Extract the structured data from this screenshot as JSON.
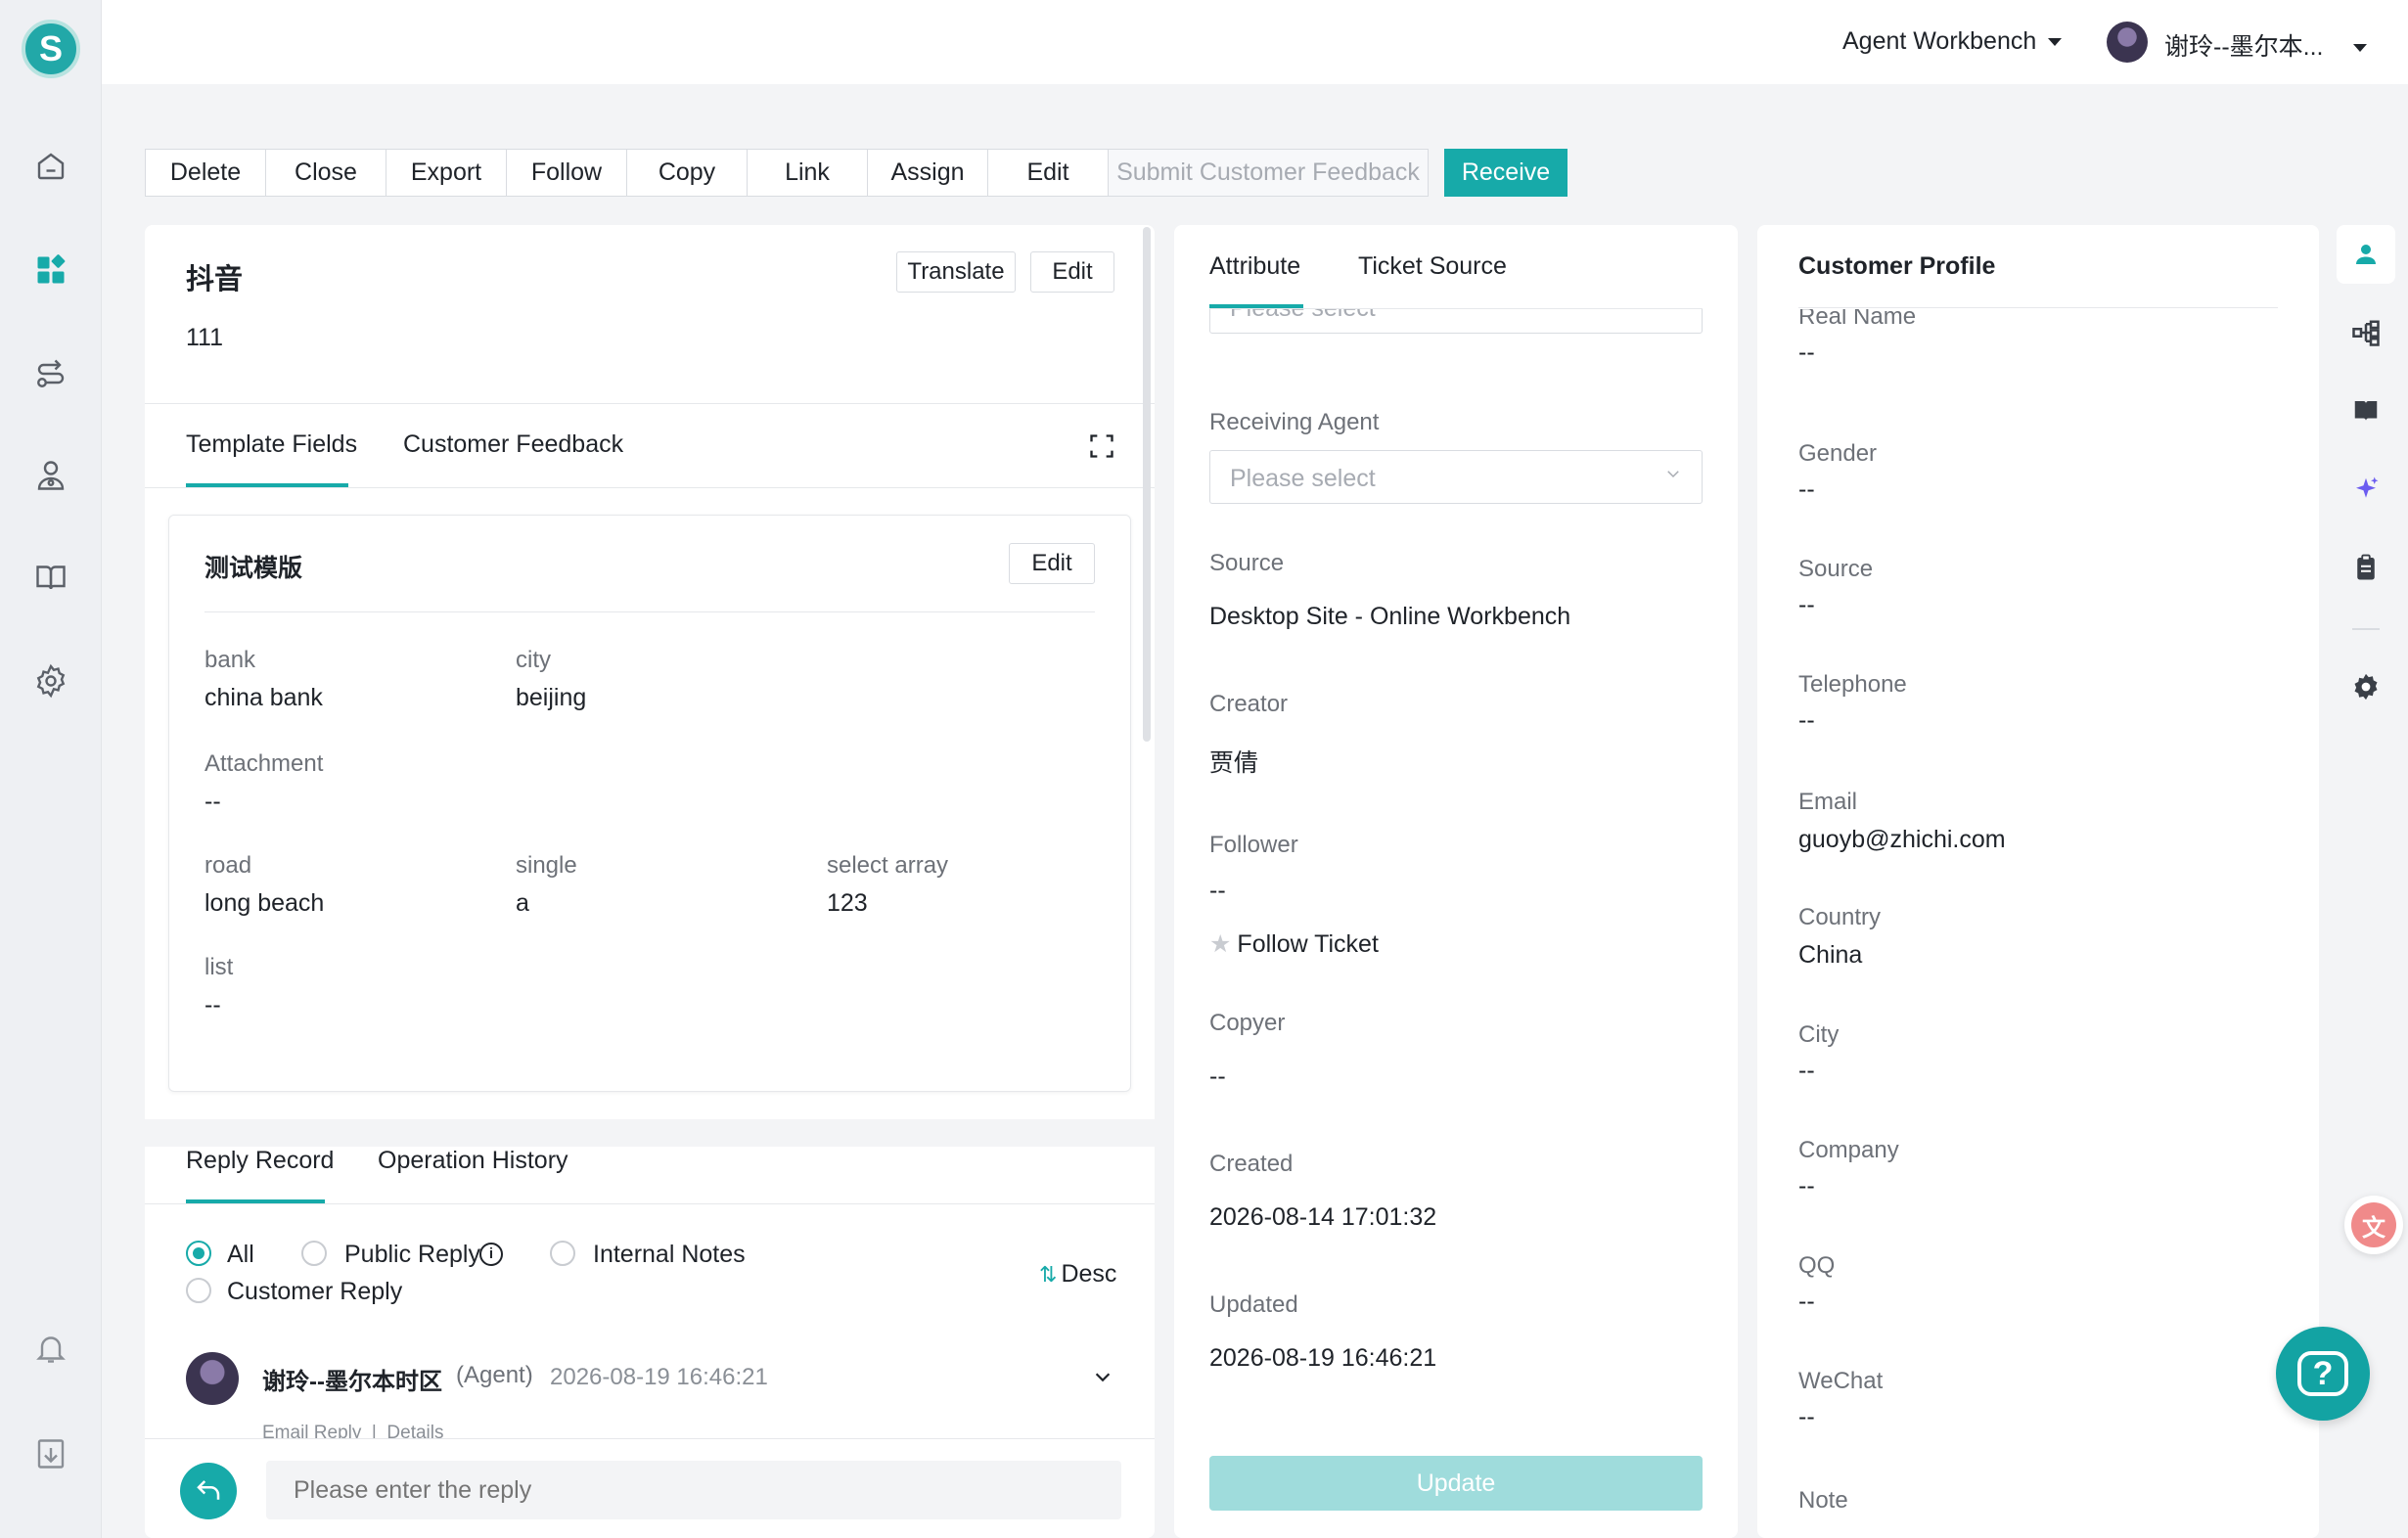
{
  "topbar": {
    "workspace": "Agent Workbench",
    "user": "谢玲--墨尔本..."
  },
  "toolbar": {
    "delete": "Delete",
    "close": "Close",
    "export": "Export",
    "follow": "Follow",
    "copy": "Copy",
    "link": "Link",
    "assign": "Assign",
    "edit": "Edit",
    "submit_feedback": "Submit Customer Feedback",
    "receive": "Receive"
  },
  "ticket": {
    "title": "抖音",
    "description": "111",
    "translate": "Translate",
    "edit": "Edit",
    "tabs": {
      "template_fields": "Template Fields",
      "customer_feedback": "Customer Feedback"
    },
    "template": {
      "name": "测试模版",
      "edit": "Edit",
      "fields": {
        "bank_label": "bank",
        "bank_value": "china bank",
        "city_label": "city",
        "city_value": "beijing",
        "attachment_label": "Attachment",
        "attachment_value": "--",
        "road_label": "road",
        "road_value": "long beach",
        "single_label": "single",
        "single_value": "a",
        "select_array_label": "select array",
        "select_array_value": "123",
        "list_label": "list",
        "list_value": "--"
      }
    },
    "reply_tabs": {
      "reply_record": "Reply Record",
      "operation_history": "Operation History"
    },
    "filters": {
      "all": "All",
      "public_reply": "Public Reply",
      "internal_notes": "Internal Notes",
      "customer_reply": "Customer Reply",
      "sort": "Desc"
    },
    "record": {
      "agent": "谢玲--墨尔本时区",
      "role": "(Agent)",
      "time": "2026-08-19 16:46:21",
      "meta": "Email Reply  |  Details"
    },
    "reply_placeholder": "Please enter the reply"
  },
  "attribute": {
    "tabs": {
      "attribute": "Attribute",
      "ticket_source": "Ticket Source"
    },
    "top_select_placeholder": "Please select",
    "receiving_agent_label": "Receiving Agent",
    "receiving_agent_placeholder": "Please select",
    "source_label": "Source",
    "source_value": "Desktop Site - Online Workbench",
    "creator_label": "Creator",
    "creator_value": "贾倩",
    "follower_label": "Follower",
    "follower_value": "--",
    "follow_ticket": "Follow Ticket",
    "copyer_label": "Copyer",
    "copyer_value": "--",
    "created_label": "Created",
    "created_value": "2026-08-14 17:01:32",
    "updated_label": "Updated",
    "updated_value": "2026-08-19 16:46:21",
    "update_button": "Update"
  },
  "profile": {
    "title": "Customer Profile",
    "real_name_label": "Real Name",
    "real_name_value": "--",
    "gender_label": "Gender",
    "gender_value": "--",
    "source_label": "Source",
    "source_value": "--",
    "telephone_label": "Telephone",
    "telephone_value": "--",
    "email_label": "Email",
    "email_value": "guoyb@zhichi.com",
    "country_label": "Country",
    "country_value": "China",
    "city_label": "City",
    "city_value": "--",
    "company_label": "Company",
    "company_value": "--",
    "qq_label": "QQ",
    "qq_value": "--",
    "wechat_label": "WeChat",
    "wechat_value": "--",
    "note_label": "Note"
  },
  "colors": {
    "accent": "#17aaa9",
    "update_disabled": "#9fdcdc",
    "help_fab": "#13a3a3"
  }
}
